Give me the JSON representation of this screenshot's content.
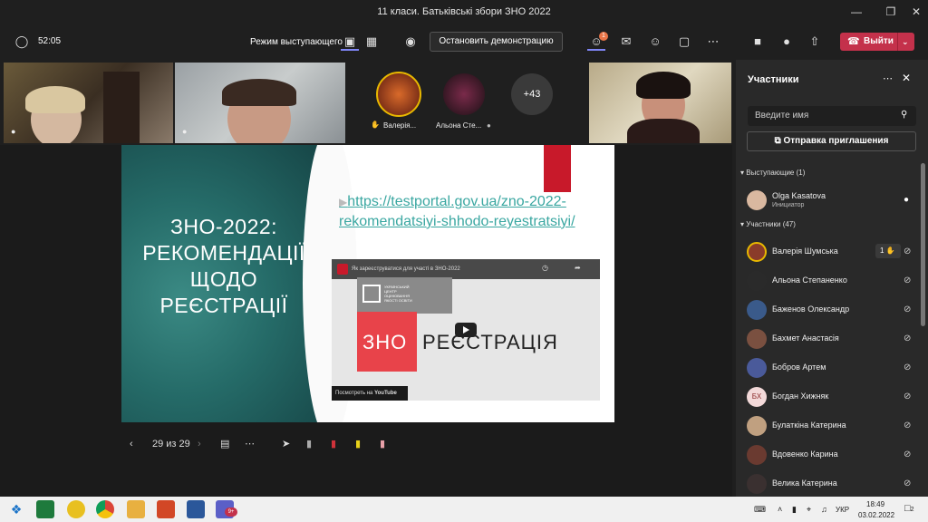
{
  "window": {
    "title": "11 класи. Батьківські збори ЗНО 2022"
  },
  "toolbar": {
    "timer": "52:05",
    "presenter_mode": "Режим выступающего",
    "stop_presenting": "Остановить демонстрацию",
    "people_badge": "1",
    "leave": "Выйти"
  },
  "video_strip": {
    "tiles": [
      {
        "name": "Валерія..."
      },
      {
        "name": "Альона Сте..."
      }
    ],
    "overflow": "+43"
  },
  "slide": {
    "title": "ЗНО-2022: РЕКОМЕНДАЦІЇ ЩОДО РЕЄСТРАЦІЇ",
    "link": "https://testportal.gov.ua/zno-2022-rekomendatsiyi-shhodo-reyestratsiyi/",
    "video": {
      "caption": "Як зареєструватися для участі в ЗНО-2022",
      "logo_text": "УКРАЇНСЬКИЙ ЦЕНТР ОЦІНЮВАННЯ ЯКОСТІ ОСВІТИ",
      "left_word": "ЗНО",
      "right_word": "РЕЄСТРАЦІЯ",
      "watch_on": "Посмотреть на",
      "platform": "YouTube"
    },
    "counter": "29 из 29"
  },
  "panel": {
    "title": "Участники",
    "search_placeholder": "Введите имя",
    "invite": "Отправка приглашения",
    "presenters_header": "Выступающие (1)",
    "attendees_header": "Участники (47)",
    "presenter": {
      "name": "Olga Kasatova",
      "role": "Инициатор"
    },
    "hand_count": "1",
    "participants": [
      {
        "name": "Валерія Шумська",
        "initials": "",
        "color": "#8a3b2a"
      },
      {
        "name": "Альона Степаненко",
        "initials": "",
        "color": "#2a2a2a"
      },
      {
        "name": "Баженов Олександр",
        "initials": "",
        "color": "#3a5a8a"
      },
      {
        "name": "Бахмет Анастасія",
        "initials": "",
        "color": "#7a5040"
      },
      {
        "name": "Бобров Артем",
        "initials": "",
        "color": "#4a5a9a"
      },
      {
        "name": "Богдан Хижняк",
        "initials": "БХ",
        "color": "#f3d9d9"
      },
      {
        "name": "Булаткіна Катерина",
        "initials": "",
        "color": "#c0a080"
      },
      {
        "name": "Вдовенко Карина",
        "initials": "",
        "color": "#6a3a30"
      },
      {
        "name": "Велика Катерина",
        "initials": "",
        "color": "#3a3030"
      }
    ]
  },
  "taskbar": {
    "lang": "УКР",
    "time": "18:49",
    "date": "03.02.2022",
    "notifications": "2",
    "teams_badge": "9+"
  }
}
